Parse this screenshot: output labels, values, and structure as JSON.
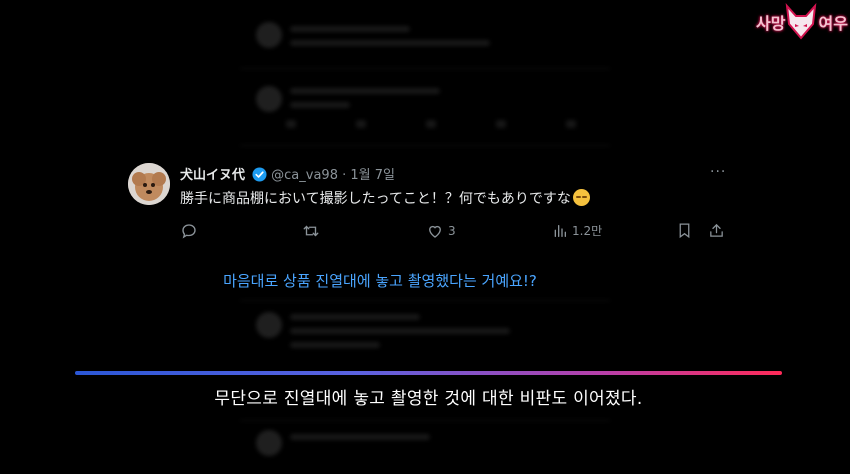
{
  "watermark": {
    "left_text": "사망",
    "right_text": "여우",
    "icon": "fox-logo-icon"
  },
  "tweet": {
    "display_name": "犬山イヌ代",
    "handle": "@ca_va98",
    "separator": "·",
    "date": "1월 7일",
    "more": "···",
    "text": "勝手に商品棚において撮影したってこと！？何でもありですな",
    "emoji": "unamused-face-emoji",
    "reply_icon": "reply-icon",
    "retweet_icon": "retweet-icon",
    "like_count": "3",
    "views_count": "1.2만",
    "bookmark_icon": "bookmark-icon",
    "share_icon": "share-icon"
  },
  "subtitles": {
    "translation": "마음대로 상품 진열대에 놓고 촬영했다는 거예요!?",
    "caption": "무단으로 진열대에 놓고 촬영한 것에 대한 비판도 이어졌다."
  },
  "colors": {
    "translation_text": "#4aa5ff",
    "divider_start": "#2b57d6",
    "divider_end": "#ff2a58",
    "verified_badge": "#1d9bf0"
  }
}
